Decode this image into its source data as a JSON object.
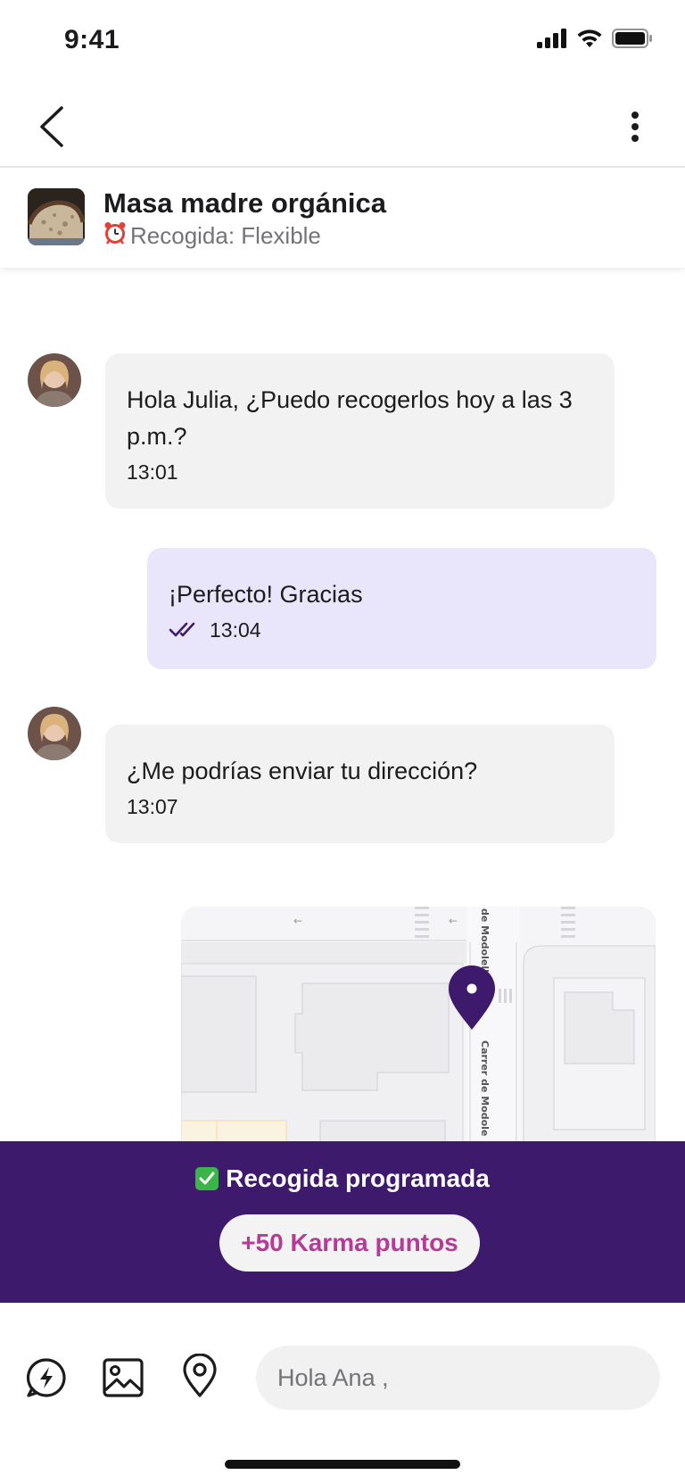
{
  "status_bar": {
    "time": "9:41"
  },
  "product": {
    "title": "Masa madre orgánica",
    "pickup_label": "Recogida: Flexible",
    "pickup_icon": "alarm-clock-icon"
  },
  "messages": [
    {
      "direction": "in",
      "text": "Hola Julia, ¿Puedo recogerlos hoy a las 3 p.m.?",
      "time": "13:01"
    },
    {
      "direction": "out",
      "text": "¡Perfecto! Gracias",
      "time": "13:04",
      "status": "read"
    },
    {
      "direction": "in",
      "text": "¿Me podrías enviar tu dirección?",
      "time": "13:07"
    }
  ],
  "map": {
    "street_labels": [
      "de Modolell",
      "Carrer de Modole"
    ],
    "pin_color": "#3d1a6b"
  },
  "banner": {
    "title": "Recogida programada",
    "karma": "+50 Karma puntos"
  },
  "composer": {
    "input_value": "Hola Ana ,"
  },
  "colors": {
    "accent": "#3d1a6b",
    "outgoing_bubble": "#e9e6fb",
    "incoming_bubble": "#f2f2f2",
    "karma_text": "#b83a97"
  }
}
